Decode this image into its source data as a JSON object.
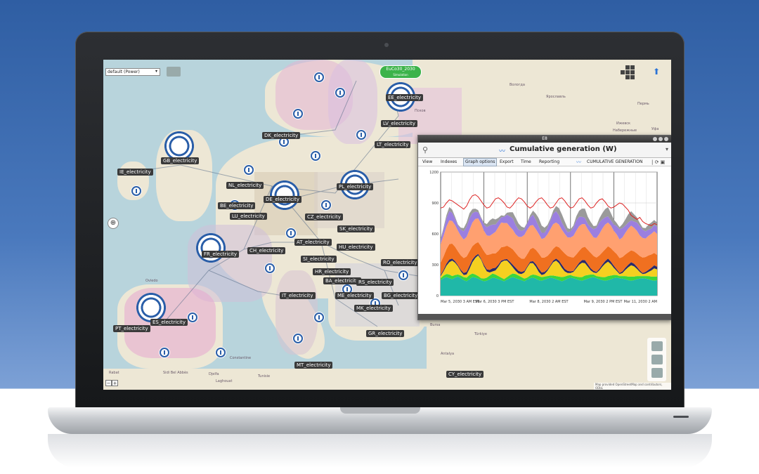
{
  "map": {
    "scenario_select": "default (Power)",
    "badge_title": "EuCo30_2030",
    "badge_sub": "Simulation",
    "attribution": "Map provided OpenStreetMap and contributors, ODbL",
    "zoom_minus": "−",
    "zoom_plus": "+",
    "pan_icon": "⊕",
    "up_icon": "⬆",
    "cities": [
      "Вологда",
      "Ярославль",
      "Пермь",
      "Набережные",
      "Псков",
      "Ижевск",
      "Уфа",
      "Bursa",
      "Türkiye",
      "Antalya",
      "Rabat",
      "Tunisie",
      "Constantine",
      "Oviedo",
      "Sidi Bel Abbès",
      "Djelfa",
      "Laghouat"
    ],
    "electricity_nodes": [
      "EE_electricity",
      "LV_electricity",
      "LT_electricity",
      "DK_electricity",
      "GB_electricity",
      "IE_electricity",
      "NL_electricity",
      "BE_electricity",
      "DE_electricity",
      "LU_electricity",
      "PL_electricity",
      "CZ_electricity",
      "SK_electricity",
      "FR_electricity",
      "CH_electricity",
      "AT_electricity",
      "HU_electricity",
      "SI_electricity",
      "RO_electricity",
      "HR_electricity",
      "BA_electricity",
      "RS_electricity",
      "IT_electricity",
      "ME_electricity",
      "BG_electricity",
      "MK_electricity",
      "ES_electricity",
      "PT_electricity",
      "GR_electricity",
      "MT_electricity",
      "CY_electricity"
    ]
  },
  "window": {
    "titlebar": "E8",
    "title": "Cumulative generation (W)",
    "menu": [
      "View",
      "Indexes",
      "Graph options",
      "Export",
      "Time",
      "Reporting"
    ],
    "active_menu": "Graph options",
    "series_label": "CUMULATIVE GENERATION",
    "separator": "|"
  },
  "chart_data": {
    "type": "area",
    "title": "",
    "xlabel": "",
    "ylabel": "",
    "ylim": [
      0,
      1200
    ],
    "yticks": [
      0,
      300,
      600,
      900,
      1200
    ],
    "xticks": [
      "Mar 5, 2030 3 AM EST",
      "Mar 6, 2030 3 PM EST",
      "Mar 8, 2030 2 AM EST",
      "Mar 9, 2030 2 PM EST",
      "Mar 11, 2030 2 AM"
    ],
    "grid": true,
    "x": [
      0,
      1,
      2,
      3,
      4,
      5,
      6,
      7,
      8,
      9,
      10,
      11,
      12,
      13,
      14,
      15,
      16,
      17,
      18,
      19,
      20,
      21,
      22,
      23,
      24,
      25,
      26,
      27,
      28,
      29,
      30,
      31,
      32,
      33,
      34,
      35,
      36,
      37,
      38,
      39,
      40,
      41,
      42,
      43,
      44,
      45,
      46,
      47,
      48,
      49,
      50,
      51,
      52,
      53,
      54,
      55,
      56,
      57,
      58,
      59,
      60,
      61,
      62,
      63,
      64,
      65,
      66,
      67,
      68,
      69,
      70,
      71,
      72,
      73,
      74,
      75
    ],
    "series": [
      {
        "color": "#20b8a8",
        "values": [
          150,
          170,
          180,
          170,
          160,
          175,
          185,
          170,
          150,
          140,
          160,
          180,
          175,
          165,
          150,
          140,
          145,
          160,
          175,
          170,
          160,
          150,
          140,
          155,
          170,
          180,
          170,
          160,
          150,
          140,
          155,
          170,
          175,
          165,
          150,
          145,
          155,
          165,
          175,
          170,
          160,
          150,
          140,
          150,
          165,
          175,
          170,
          160,
          150,
          145,
          155,
          165,
          175,
          180,
          170,
          160,
          150,
          145,
          150,
          160,
          170,
          175,
          170,
          165,
          160,
          150,
          145,
          150,
          160,
          165,
          170,
          165,
          160,
          150,
          145,
          150
        ]
      },
      {
        "color": "#3dd63d",
        "values": [
          20,
          25,
          30,
          35,
          30,
          25,
          20,
          25,
          30,
          35,
          40,
          35,
          30,
          25,
          20,
          25,
          30,
          35,
          40,
          35,
          30,
          25,
          20,
          25,
          30,
          35,
          40,
          35,
          30,
          25,
          20,
          25,
          30,
          35,
          40,
          35,
          30,
          25,
          20,
          25,
          30,
          35,
          40,
          35,
          30,
          25,
          20,
          25,
          30,
          35,
          40,
          35,
          30,
          25,
          20,
          25,
          30,
          35,
          40,
          35,
          30,
          25,
          20,
          25,
          30,
          35,
          40,
          35,
          30,
          25,
          20,
          25,
          30,
          35,
          40,
          35
        ]
      },
      {
        "color": "#f5d020",
        "values": [
          20,
          40,
          80,
          120,
          150,
          120,
          80,
          40,
          20,
          30,
          60,
          110,
          160,
          200,
          180,
          120,
          60,
          30,
          20,
          40,
          90,
          150,
          180,
          160,
          110,
          60,
          30,
          20,
          30,
          60,
          100,
          120,
          110,
          80,
          40,
          20,
          25,
          50,
          90,
          130,
          150,
          130,
          90,
          50,
          25,
          20,
          40,
          80,
          120,
          140,
          120,
          80,
          40,
          20,
          30,
          60,
          100,
          130,
          140,
          110,
          70,
          40,
          20,
          30,
          60,
          90,
          110,
          100,
          70,
          40,
          20,
          25,
          40,
          60,
          80,
          70
        ]
      },
      {
        "color": "#2a2a6a",
        "values": [
          10,
          15,
          20,
          25,
          20,
          15,
          10,
          15,
          20,
          25,
          30,
          25,
          20,
          15,
          10,
          15,
          20,
          25,
          30,
          25,
          20,
          15,
          10,
          15,
          20,
          25,
          30,
          25,
          20,
          15,
          10,
          15,
          20,
          25,
          30,
          25,
          20,
          15,
          10,
          15,
          20,
          25,
          30,
          25,
          20,
          15,
          10,
          15,
          20,
          25,
          30,
          25,
          20,
          15,
          10,
          15,
          20,
          25,
          30,
          25,
          20,
          15,
          10,
          15,
          20,
          25,
          30,
          25,
          20,
          15,
          10,
          15,
          20,
          25,
          30,
          25
        ]
      },
      {
        "color": "#f07020",
        "values": [
          120,
          130,
          140,
          150,
          145,
          140,
          135,
          140,
          145,
          150,
          140,
          130,
          120,
          115,
          120,
          130,
          140,
          150,
          145,
          140,
          135,
          130,
          125,
          130,
          140,
          150,
          145,
          140,
          130,
          120,
          115,
          120,
          130,
          140,
          150,
          145,
          140,
          130,
          120,
          115,
          120,
          130,
          140,
          150,
          145,
          140,
          130,
          120,
          115,
          120,
          130,
          140,
          150,
          145,
          140,
          130,
          120,
          115,
          120,
          130,
          140,
          150,
          145,
          140,
          130,
          120,
          115,
          120,
          130,
          140,
          150,
          145,
          140,
          130,
          120,
          115
        ]
      },
      {
        "color": "#ffa070",
        "values": [
          180,
          200,
          220,
          230,
          220,
          210,
          200,
          190,
          180,
          190,
          210,
          230,
          240,
          230,
          220,
          200,
          190,
          180,
          190,
          210,
          230,
          240,
          230,
          220,
          200,
          190,
          180,
          190,
          210,
          230,
          240,
          230,
          220,
          200,
          190,
          180,
          190,
          210,
          230,
          240,
          230,
          220,
          200,
          190,
          180,
          190,
          210,
          230,
          240,
          230,
          220,
          200,
          190,
          180,
          190,
          210,
          230,
          240,
          230,
          220,
          200,
          190,
          180,
          190,
          210,
          230,
          240,
          230,
          220,
          200,
          190,
          180,
          190,
          200,
          210,
          205
        ]
      },
      {
        "color": "#9b7fe0",
        "values": [
          40,
          60,
          80,
          90,
          80,
          60,
          50,
          60,
          80,
          100,
          110,
          90,
          70,
          60,
          50,
          60,
          80,
          100,
          90,
          70,
          60,
          50,
          60,
          80,
          100,
          110,
          90,
          70,
          60,
          50,
          60,
          80,
          100,
          90,
          70,
          60,
          50,
          60,
          80,
          100,
          110,
          90,
          70,
          60,
          50,
          60,
          80,
          100,
          90,
          70,
          60,
          50,
          60,
          80,
          100,
          110,
          90,
          70,
          60,
          50,
          60,
          80,
          100,
          90,
          70,
          60,
          50,
          60,
          80,
          90,
          80,
          70,
          60,
          50,
          60,
          70
        ]
      },
      {
        "color": "#9a9a9a",
        "values": [
          10,
          20,
          30,
          40,
          30,
          20,
          10,
          20,
          30,
          40,
          50,
          40,
          30,
          20,
          10,
          20,
          30,
          50,
          60,
          50,
          30,
          20,
          10,
          20,
          40,
          60,
          70,
          60,
          40,
          20,
          10,
          20,
          40,
          60,
          80,
          70,
          50,
          30,
          20,
          30,
          50,
          70,
          80,
          60,
          40,
          20,
          20,
          40,
          60,
          80,
          90,
          70,
          50,
          30,
          20,
          40,
          60,
          80,
          90,
          70,
          50,
          30,
          20,
          40,
          60,
          80,
          90,
          70,
          50,
          30,
          20,
          30,
          50,
          60,
          50,
          40
        ]
      }
    ],
    "demand_line": {
      "color": "#dd2222",
      "values": [
        850,
        860,
        900,
        930,
        920,
        900,
        880,
        860,
        840,
        870,
        930,
        970,
        980,
        960,
        920,
        880,
        850,
        860,
        900,
        940,
        950,
        930,
        900,
        860,
        850,
        880,
        920,
        950,
        940,
        910,
        870,
        850,
        870,
        910,
        940,
        950,
        920,
        880,
        850,
        860,
        900,
        940,
        950,
        920,
        880,
        850,
        860,
        900,
        940,
        950,
        920,
        880,
        850,
        860,
        900,
        930,
        940,
        910,
        870,
        850,
        860,
        880,
        900,
        890,
        860,
        830,
        780,
        760,
        740,
        760,
        720,
        700,
        690,
        680,
        700,
        690
      ]
    }
  }
}
